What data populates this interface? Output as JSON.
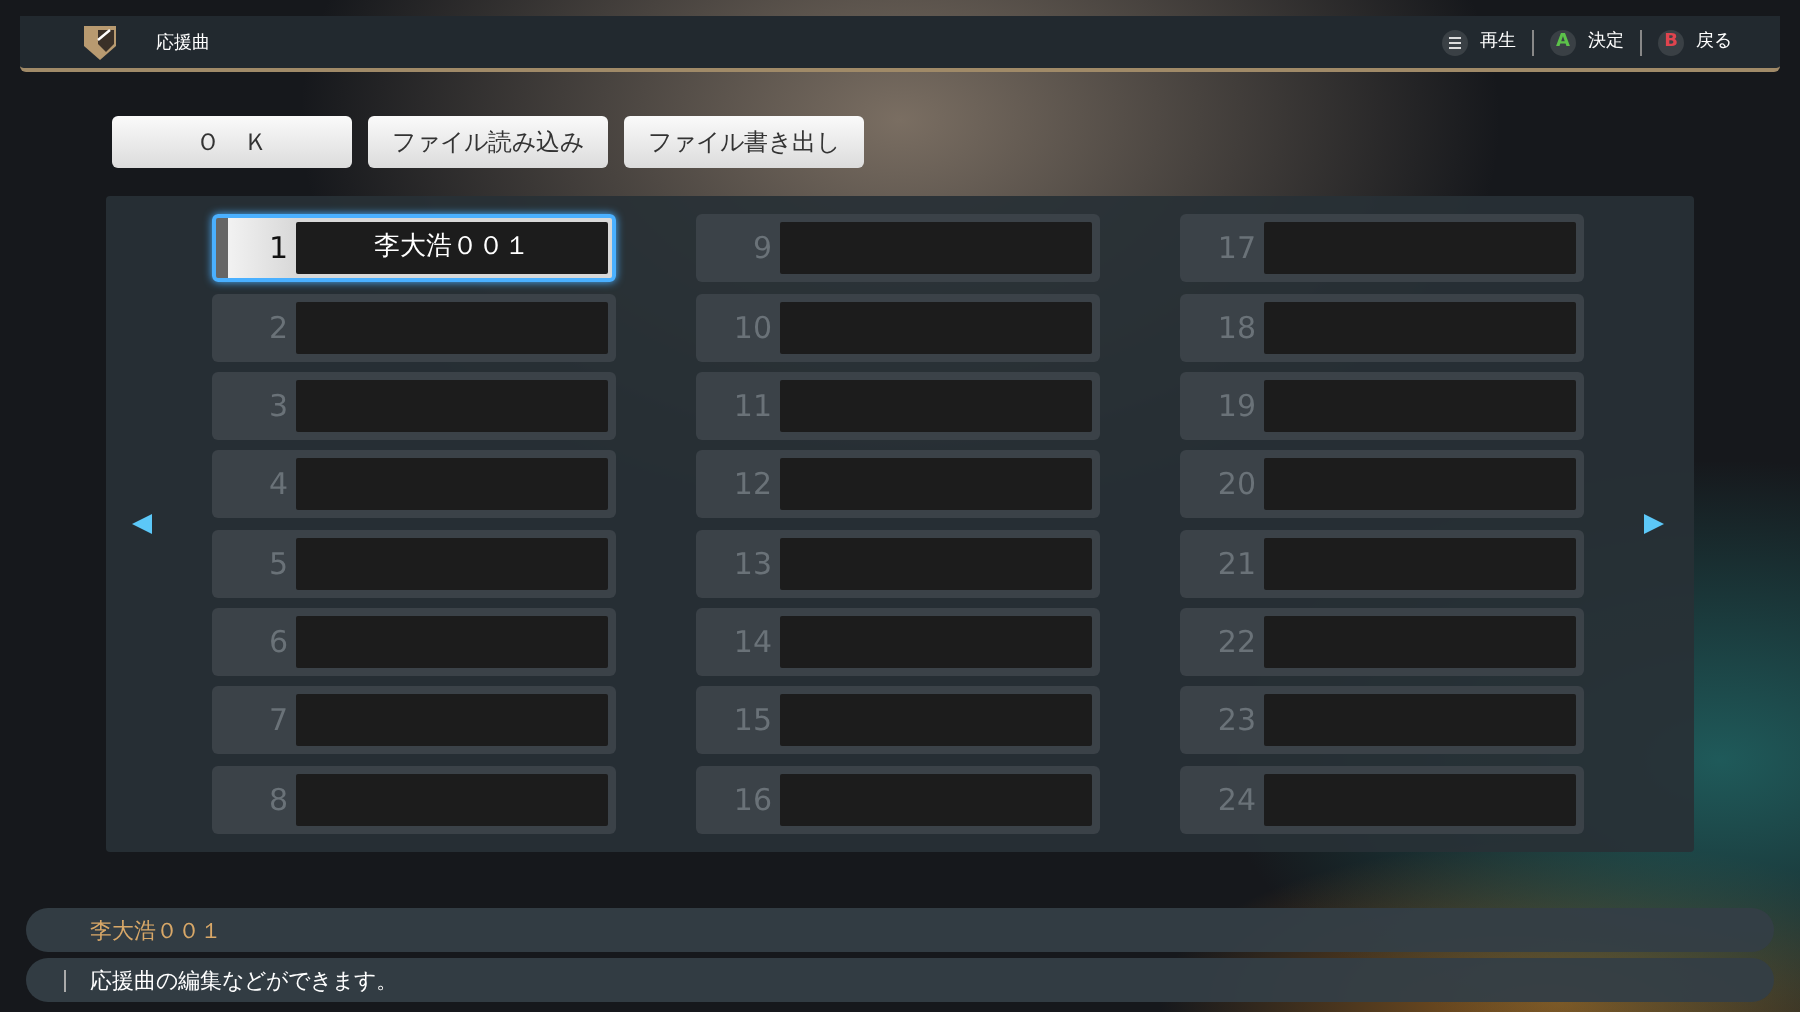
{
  "header": {
    "title": "応援曲",
    "hints": [
      {
        "kind": "menu",
        "label": "再生"
      },
      {
        "kind": "key",
        "key": "A",
        "color": "#5cc24a",
        "label": "決定"
      },
      {
        "kind": "key",
        "key": "B",
        "color": "#e0444e",
        "label": "戻る"
      }
    ]
  },
  "buttons": [
    "Ｏ　Ｋ",
    "ファイル読み込み",
    "ファイル書き出し"
  ],
  "slots": [
    {
      "number": "1",
      "name": "李大浩００１",
      "selected": true
    },
    {
      "number": "2",
      "selected": false
    },
    {
      "number": "3",
      "selected": false
    },
    {
      "number": "4",
      "selected": false
    },
    {
      "number": "5",
      "selected": false
    },
    {
      "number": "6",
      "selected": false
    },
    {
      "number": "7",
      "selected": false
    },
    {
      "number": "8",
      "selected": false
    },
    {
      "number": "9",
      "selected": false
    },
    {
      "number": "10",
      "selected": false
    },
    {
      "number": "11",
      "selected": false
    },
    {
      "number": "12",
      "selected": false
    },
    {
      "number": "13",
      "selected": false
    },
    {
      "number": "14",
      "selected": false
    },
    {
      "number": "15",
      "selected": false
    },
    {
      "number": "16",
      "selected": false
    },
    {
      "number": "17",
      "selected": false
    },
    {
      "number": "18",
      "selected": false
    },
    {
      "number": "19",
      "selected": false
    },
    {
      "number": "20",
      "selected": false
    },
    {
      "number": "21",
      "selected": false
    },
    {
      "number": "22",
      "selected": false
    },
    {
      "number": "23",
      "selected": false
    },
    {
      "number": "24",
      "selected": false
    }
  ],
  "info": {
    "title": "李大浩００１",
    "description": "応援曲の編集などができます。"
  }
}
